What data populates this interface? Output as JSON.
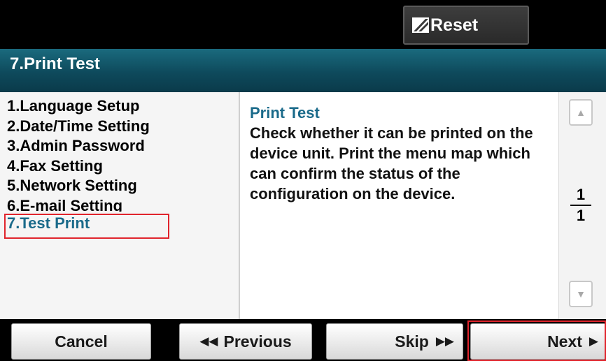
{
  "header": {
    "reset_label": "Reset",
    "title": "7.Print Test"
  },
  "menu": {
    "items": [
      {
        "label": "1.Language Setup"
      },
      {
        "label": "2.Date/Time Setting"
      },
      {
        "label": "3.Admin Password"
      },
      {
        "label": "4.Fax Setting"
      },
      {
        "label": "5.Network Setting"
      },
      {
        "label": "6.E-mail Setting"
      },
      {
        "label": "7.Test Print"
      }
    ],
    "selected_index": 6
  },
  "description": {
    "title": "Print Test",
    "body": "Check whether it can be printed on the device unit. Print the menu map which can confirm the status of the configuration on the device."
  },
  "pager": {
    "current": "1",
    "total": "1",
    "up_icon": "triangle-up-icon",
    "down_icon": "triangle-down-icon"
  },
  "footer": {
    "cancel_label": "Cancel",
    "previous_label": "Previous",
    "skip_label": "Skip",
    "next_label": "Next",
    "previous_icon": "double-left-arrow-icon",
    "skip_icon": "double-right-arrow-icon",
    "next_icon": "right-triangle-icon"
  },
  "colors": {
    "title_bar": "#0e4a5c",
    "accent_text": "#1a6a8a",
    "highlight": "#e0242c"
  }
}
